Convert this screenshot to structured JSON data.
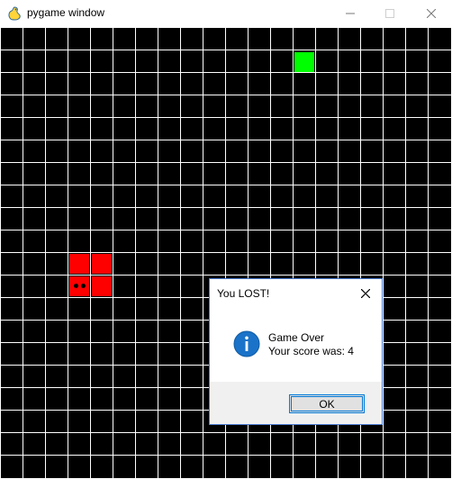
{
  "window": {
    "title": "pygame window",
    "minimize_glyph": "—",
    "maximize_glyph": "☐",
    "close_glyph": "✕"
  },
  "game": {
    "rows": 20,
    "background_color": "#000000",
    "grid_color": "#ffffff",
    "snake_color": "#ff0000",
    "snack_color": "#00ff00",
    "snake_cells": [
      [
        3,
        10
      ],
      [
        4,
        10
      ],
      [
        3,
        11
      ],
      [
        4,
        11
      ]
    ],
    "head_cell": [
      3,
      11
    ],
    "snack_cell": [
      13,
      1
    ]
  },
  "dialog": {
    "title": "You LOST!",
    "close_glyph": "✕",
    "icon": "info-icon",
    "line1": "Game Over",
    "line2": "Your score was: 4",
    "ok_label": "OK"
  }
}
